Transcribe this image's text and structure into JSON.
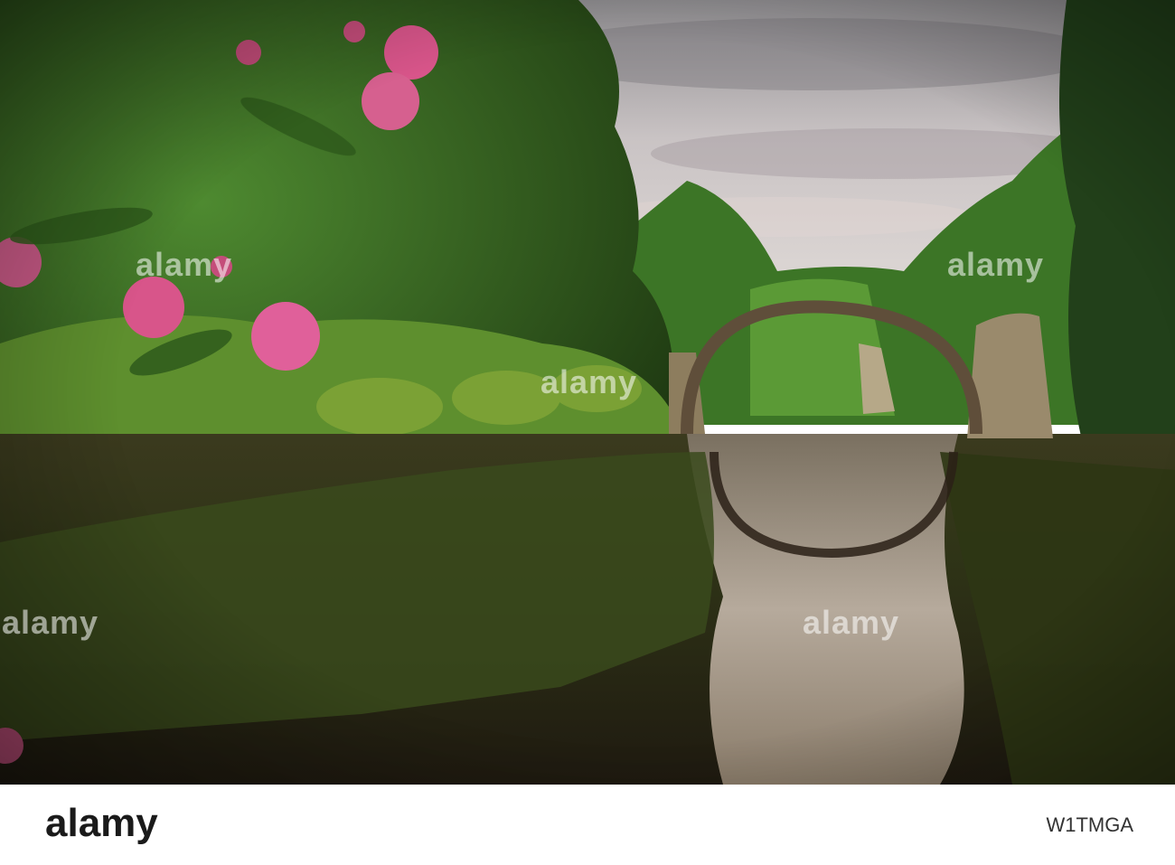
{
  "watermark": {
    "text": "alamy"
  },
  "footer": {
    "logo": "alamy",
    "image_id": "W1TMGA"
  },
  "colors": {
    "sky": "#c9c4c6",
    "foliage": "#3f7a2a",
    "water": "#4a3e24",
    "flowers": "#d8558a",
    "stone": "#7a6a58"
  }
}
